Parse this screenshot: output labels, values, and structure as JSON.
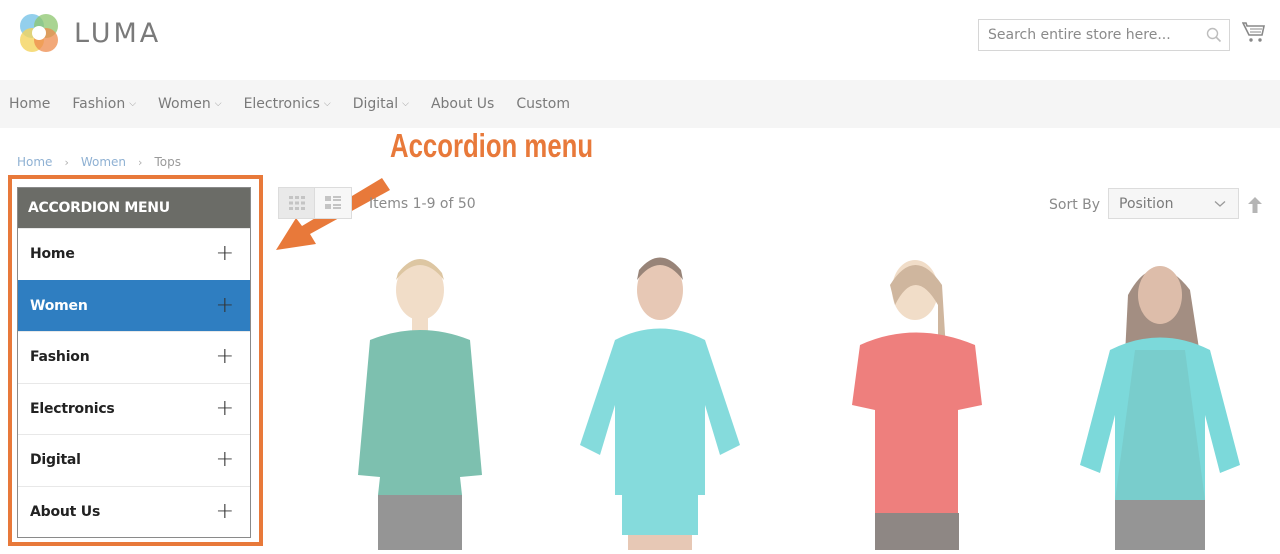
{
  "header": {
    "logo_text": "LUMA",
    "search_placeholder": "Search entire store here...",
    "icons": {
      "search": "search-icon",
      "cart": "cart-icon"
    }
  },
  "nav": {
    "items": [
      {
        "label": "Home",
        "has_dropdown": false
      },
      {
        "label": "Fashion",
        "has_dropdown": true
      },
      {
        "label": "Women",
        "has_dropdown": true
      },
      {
        "label": "Electronics",
        "has_dropdown": true
      },
      {
        "label": "Digital",
        "has_dropdown": true
      },
      {
        "label": "About Us",
        "has_dropdown": false
      },
      {
        "label": "Custom",
        "has_dropdown": false
      }
    ],
    "dropdown_glyph": "⌵"
  },
  "breadcrumb": {
    "items": [
      "Home",
      "Women",
      "Tops"
    ],
    "separator": "›"
  },
  "annotation": {
    "callout_text": "Accordion menu",
    "color": "#e8793a"
  },
  "accordion": {
    "title": "ACCORDION MENU",
    "expand_glyph": "+",
    "items": [
      {
        "label": "Home",
        "active": false
      },
      {
        "label": "Women",
        "active": true
      },
      {
        "label": "Fashion",
        "active": false
      },
      {
        "label": "Electronics",
        "active": false
      },
      {
        "label": "Digital",
        "active": false
      },
      {
        "label": "About Us",
        "active": false
      }
    ],
    "active_color": "#2f7ec1",
    "header_color": "#6b6c67"
  },
  "toolbar": {
    "modes": [
      "grid",
      "list"
    ],
    "active_mode": "grid",
    "count_text": "Items 1-9 of 50",
    "sort_label": "Sort By",
    "sort_value": "Position",
    "sort_direction": "ascending"
  },
  "products": [
    {
      "description": "woman in long-sleeve green hoodie top",
      "top_color": "#2e9a7f"
    },
    {
      "description": "woman in turquoise hoodie with patterned shorts",
      "top_color": "#3cc6c8"
    },
    {
      "description": "woman in red cowl-neck short-sleeve top",
      "top_color": "#e5322e"
    },
    {
      "description": "woman in two-tone turquoise long-sleeve hoodie",
      "top_color": "#2dc2c4"
    }
  ]
}
